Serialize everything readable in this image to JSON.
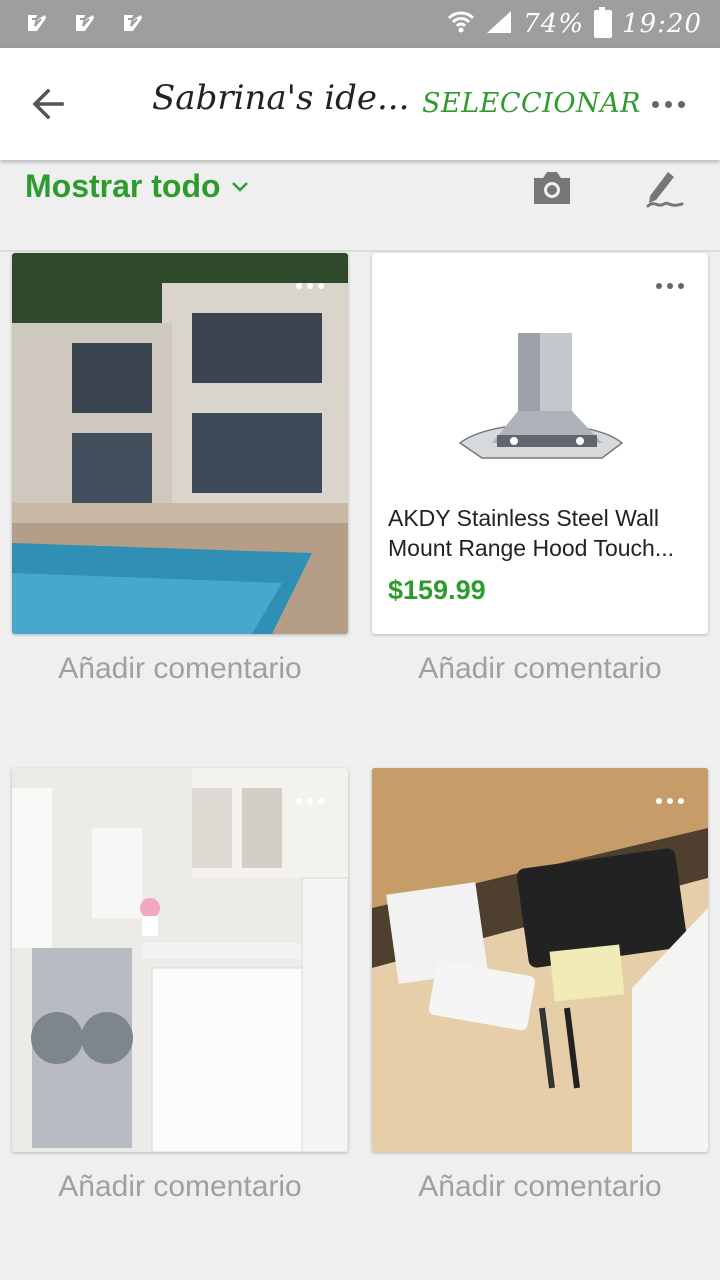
{
  "status_bar": {
    "battery": "74%",
    "time": "19:20"
  },
  "app_bar": {
    "title": "Sabrina's ide...",
    "select_label": "SELECCIONAR"
  },
  "filter": {
    "label": "Mostrar todo"
  },
  "cards": [
    {
      "type": "image",
      "depicts": "modern house with pool",
      "comment": "Añadir comentario"
    },
    {
      "type": "product",
      "depicts": "range hood",
      "title_line1": "AKDY Stainless Steel Wall",
      "title_line2": "Mount Range Hood Touch...",
      "price": "$159.99",
      "comment": "Añadir comentario"
    },
    {
      "type": "image",
      "depicts": "white laundry room",
      "comment": "Añadir comentario"
    },
    {
      "type": "image",
      "depicts": "drawer with charging station",
      "comment": "Añadir comentario"
    }
  ],
  "colors": {
    "accent": "#2d9b2d",
    "status_bar": "#9e9e9e",
    "background": "#efefef"
  }
}
